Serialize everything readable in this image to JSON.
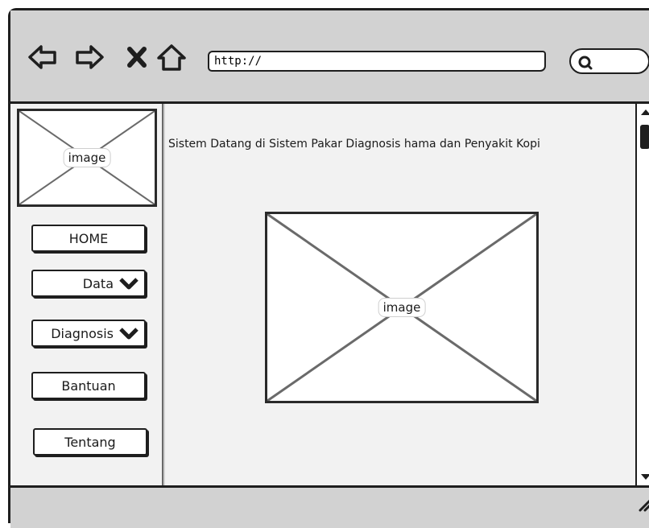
{
  "browser": {
    "url": "http://",
    "icons": [
      "back-arrow-icon",
      "forward-arrow-icon",
      "close-icon",
      "home-icon",
      "search-icon"
    ]
  },
  "sidebar": {
    "logo_label": "image",
    "menu": [
      {
        "label": "HOME",
        "has_dropdown": false
      },
      {
        "label": "Data",
        "has_dropdown": true
      },
      {
        "label": "Diagnosis",
        "has_dropdown": true
      },
      {
        "label": "Bantuan",
        "has_dropdown": false
      },
      {
        "label": "Tentang",
        "has_dropdown": false
      }
    ]
  },
  "main": {
    "title": "Sistem Datang di Sistem Pakar Diagnosis hama dan Penyakit Kopi",
    "image_label": "image"
  },
  "colors": {
    "chrome": "#d2d2d2",
    "panel": "#f2f2f2",
    "stroke": "#1e1e1e"
  }
}
